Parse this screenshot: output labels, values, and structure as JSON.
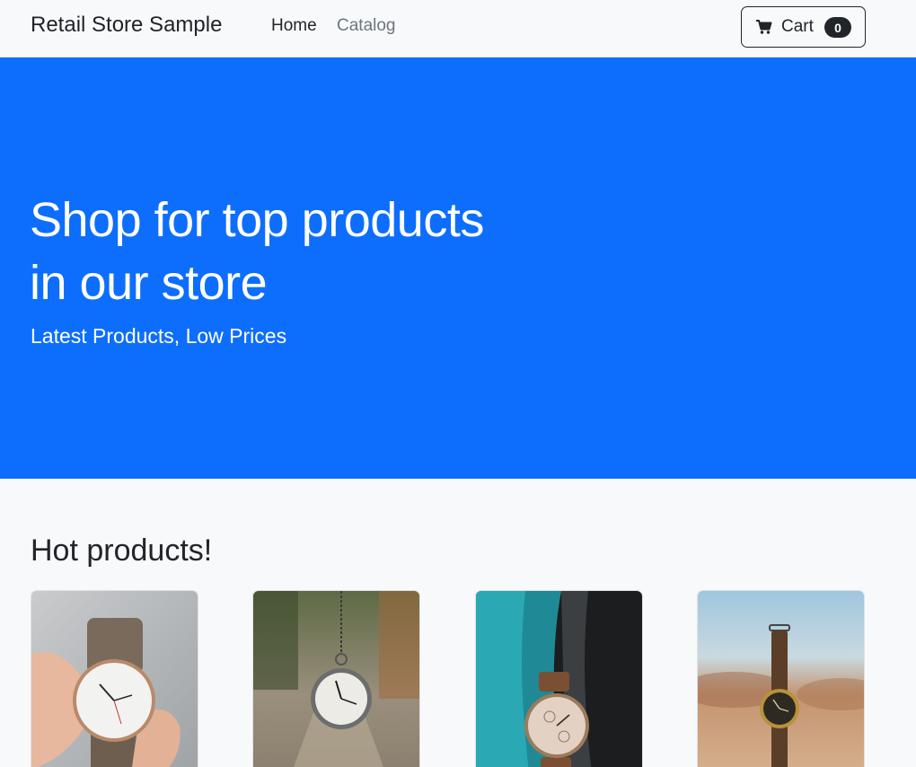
{
  "navbar": {
    "brand": "Retail Store Sample",
    "links": [
      {
        "label": "Home",
        "active": true
      },
      {
        "label": "Catalog",
        "active": false
      }
    ],
    "cart": {
      "label": "Cart",
      "count": "0",
      "icon": "cart-icon"
    }
  },
  "hero": {
    "title_line1": "Shop for top products",
    "title_line2": "in our store",
    "subtitle": "Latest Products, Low Prices",
    "background": "#0d6efd"
  },
  "products_section": {
    "title": "Hot products!",
    "items": [
      {
        "image": "wristwatch-in-hand"
      },
      {
        "image": "pocket-watch-hanging"
      },
      {
        "image": "wristwatch-on-teal-fabric"
      },
      {
        "image": "wristwatch-in-desert"
      }
    ]
  },
  "colors": {
    "primary": "#0d6efd",
    "dark": "#212529",
    "muted": "#6c757d"
  }
}
